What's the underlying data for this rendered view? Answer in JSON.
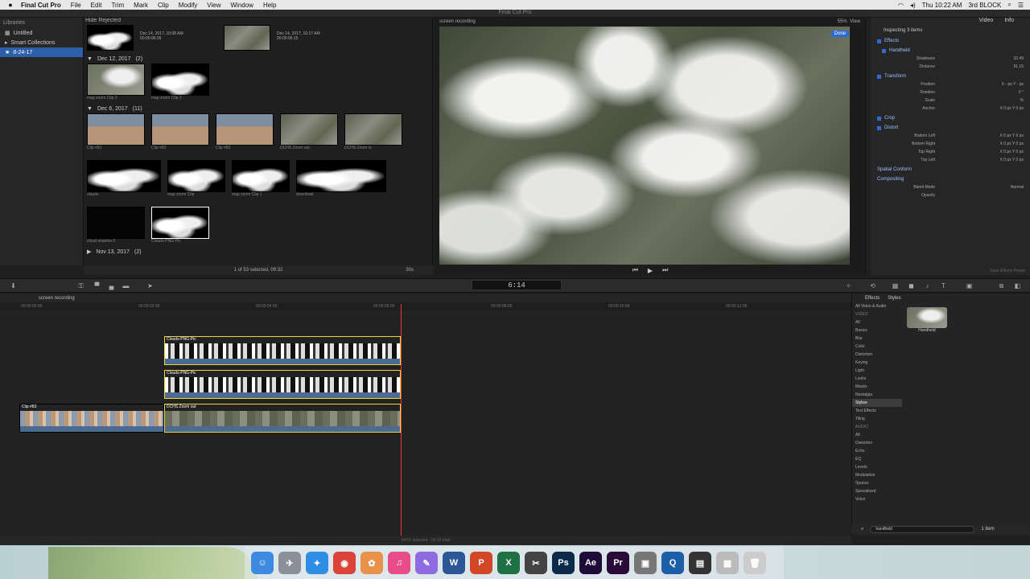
{
  "menubar": {
    "apple": "",
    "items": [
      "Final Cut Pro",
      "File",
      "Edit",
      "Trim",
      "Mark",
      "Clip",
      "Modify",
      "View",
      "Window",
      "Help"
    ],
    "clock": "Thu 10:22 AM",
    "user": "3rd BLOCK"
  },
  "window_title": "Final Cut Pro",
  "libraries": {
    "title": "Libraries",
    "items": [
      "Untitled",
      "Smart Collections",
      "8-24-17"
    ]
  },
  "browser": {
    "header": "Hide Rejected",
    "top_clips": [
      {
        "label": "Dec 14, 2017, 10:08 AM",
        "sub": "00:00:06:09"
      },
      {
        "label": "Dec 14, 2017, 10:17 AM",
        "sub": "00:00:06:15"
      }
    ],
    "groups": [
      {
        "date": "Dec 12, 2017",
        "count": "(2)",
        "clips": [
          "map zoom Clip 2",
          "map zoom Clip 3"
        ]
      },
      {
        "date": "Dec 6, 2017",
        "count": "(11)",
        "clips": [
          "Clip #81",
          "Clip #82",
          "Clip #83",
          "DCHS Zoom out",
          "DCHS Zoom in",
          "clouds",
          "map zoom Clip",
          "map zoom Clip 1",
          "download",
          "cloud-shadow-2",
          "Clouds-PNG-Pic"
        ]
      },
      {
        "date": "Nov 13, 2017",
        "count": "(2)",
        "clips": []
      }
    ],
    "footer": "1 of 53 selected, 09:32",
    "zoom": "30s"
  },
  "viewer": {
    "title": "screen recording",
    "zoom": "55%",
    "view_menu": "View",
    "done": "Done"
  },
  "inspector": {
    "tabs": [
      "Video",
      "Info"
    ],
    "header": "Inspecting 3 items",
    "sections": [
      {
        "name": "Effects",
        "rows": []
      },
      {
        "name": "Handheld",
        "rows": [
          {
            "label": "Shakiness",
            "value": "10.49"
          },
          {
            "label": "Distance",
            "value": "91.15"
          }
        ]
      },
      {
        "name": "Transform",
        "rows": [
          {
            "label": "Position",
            "value": "X  -  px  Y  -  px"
          },
          {
            "label": "Rotation",
            "value": "0 °"
          },
          {
            "label": "Scale",
            "value": "%"
          },
          {
            "label": "Anchor",
            "value": "X  0  px  Y  0  px"
          }
        ]
      },
      {
        "name": "Crop",
        "rows": []
      },
      {
        "name": "Distort",
        "rows": [
          {
            "label": "Bottom Left",
            "value": "X  0  px  Y  0  px"
          },
          {
            "label": "Bottom Right",
            "value": "X  0  px  Y  0  px"
          },
          {
            "label": "Top Right",
            "value": "X  0  px  Y  0  px"
          },
          {
            "label": "Top Left",
            "value": "X  0  px  Y  0  px"
          }
        ]
      },
      {
        "name": "Spatial Conform",
        "rows": []
      },
      {
        "name": "Compositing",
        "rows": [
          {
            "label": "Blend Mode",
            "value": "Normal"
          },
          {
            "label": "Opacity",
            "value": ""
          }
        ]
      }
    ],
    "save_preset": "Save Effects Preset"
  },
  "toolbar": {
    "timecode": "6:14"
  },
  "timeline": {
    "project": "screen recording",
    "ruler": [
      "00:00:00:00",
      "00:00:02:00",
      "00:00:04:00",
      "00:00:06:00",
      "00:00:08:00",
      "00:00:10:00",
      "00:00:12:00"
    ],
    "clips": [
      {
        "name": "Clouds-PNG-Pic"
      },
      {
        "name": "Clouds-PNG-Pic"
      },
      {
        "name": "DCHS Zoom out"
      },
      {
        "name": "Clip #83"
      }
    ],
    "footer": "04:01 selected - 06:15 total"
  },
  "effects": {
    "tabs": [
      "Effects",
      "Styles"
    ],
    "categories": [
      {
        "label": "All Video & Audio",
        "kind": "item"
      },
      {
        "label": "VIDEO",
        "kind": "section"
      },
      {
        "label": "All",
        "kind": "item"
      },
      {
        "label": "Basics",
        "kind": "item"
      },
      {
        "label": "Blur",
        "kind": "item"
      },
      {
        "label": "Color",
        "kind": "item"
      },
      {
        "label": "Distortion",
        "kind": "item"
      },
      {
        "label": "Keying",
        "kind": "item"
      },
      {
        "label": "Light",
        "kind": "item"
      },
      {
        "label": "Looks",
        "kind": "item"
      },
      {
        "label": "Masks",
        "kind": "item"
      },
      {
        "label": "Nostalgia",
        "kind": "item"
      },
      {
        "label": "Stylize",
        "kind": "selected"
      },
      {
        "label": "Text Effects",
        "kind": "item"
      },
      {
        "label": "Tiling",
        "kind": "item"
      },
      {
        "label": "AUDIO",
        "kind": "section"
      },
      {
        "label": "All",
        "kind": "item"
      },
      {
        "label": "Distortion",
        "kind": "item"
      },
      {
        "label": "Echo",
        "kind": "item"
      },
      {
        "label": "EQ",
        "kind": "item"
      },
      {
        "label": "Levels",
        "kind": "item"
      },
      {
        "label": "Modulation",
        "kind": "item"
      },
      {
        "label": "Spaces",
        "kind": "item"
      },
      {
        "label": "Specialized",
        "kind": "item"
      },
      {
        "label": "Voice",
        "kind": "item"
      }
    ],
    "result": "Handheld",
    "search_value": "handheld",
    "count": "1 item"
  },
  "dock": {
    "icons": [
      {
        "name": "finder-icon",
        "glyph": "☺",
        "color": "#3d8be0"
      },
      {
        "name": "launchpad-icon",
        "glyph": "✈",
        "color": "#8a8f99"
      },
      {
        "name": "safari-icon",
        "glyph": "✦",
        "color": "#2f8de4"
      },
      {
        "name": "chrome-icon",
        "glyph": "◉",
        "color": "#db4437"
      },
      {
        "name": "photos-icon",
        "glyph": "✿",
        "color": "#e8914a"
      },
      {
        "name": "itunes-icon",
        "glyph": "♫",
        "color": "#e84d8a"
      },
      {
        "name": "pencil-app-icon",
        "glyph": "✎",
        "color": "#8e6be0"
      },
      {
        "name": "word-icon",
        "glyph": "W",
        "color": "#2b5797"
      },
      {
        "name": "powerpoint-icon",
        "glyph": "P",
        "color": "#d24726"
      },
      {
        "name": "excel-icon",
        "glyph": "X",
        "color": "#1e7145"
      },
      {
        "name": "final-cut-icon",
        "glyph": "✂",
        "color": "#444"
      },
      {
        "name": "photoshop-icon",
        "glyph": "Ps",
        "color": "#0c2a4a"
      },
      {
        "name": "after-effects-icon",
        "glyph": "Ae",
        "color": "#1f0b3a"
      },
      {
        "name": "premiere-icon",
        "glyph": "Pr",
        "color": "#2a0a38"
      },
      {
        "name": "compressor-icon",
        "glyph": "▣",
        "color": "#777"
      },
      {
        "name": "quicktime-icon",
        "glyph": "Q",
        "color": "#1a5fa8"
      },
      {
        "name": "folder-icon",
        "glyph": "▤",
        "color": "#333"
      },
      {
        "name": "documents-icon",
        "glyph": "▦",
        "color": "#bbb"
      },
      {
        "name": "trash-icon",
        "glyph": "🗑",
        "color": "#ccc"
      }
    ]
  }
}
